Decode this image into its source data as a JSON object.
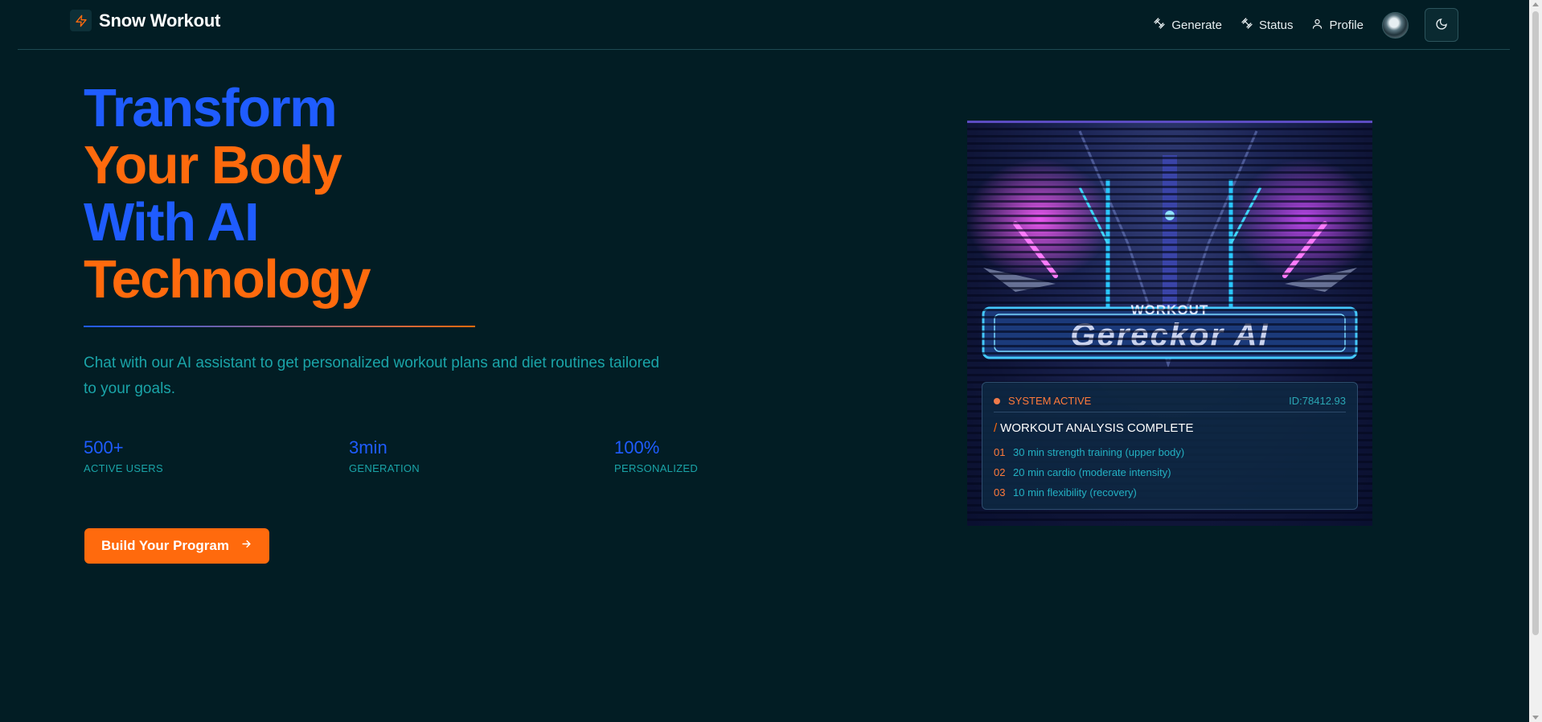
{
  "app": {
    "brand_name": "Snow Workout",
    "brand_icon": "zap-icon"
  },
  "nav": {
    "items": [
      {
        "label": "Generate",
        "icon": "dumbbell-icon"
      },
      {
        "label": "Status",
        "icon": "dumbbell-icon"
      },
      {
        "label": "Profile",
        "icon": "user-icon"
      }
    ],
    "theme_toggle_icon": "moon-icon"
  },
  "hero": {
    "title_lines": [
      "Transform",
      "Your Body",
      "With AI",
      "Technology"
    ],
    "subtitle": "Chat with our AI assistant to get personalized workout plans and diet routines tailored to your goals.",
    "stats": [
      {
        "value": "500+",
        "label": "ACTIVE USERS"
      },
      {
        "value": "3min",
        "label": "GENERATION"
      },
      {
        "value": "100%",
        "label": "PERSONALIZED"
      }
    ],
    "cta_label": "Build Your Program",
    "cta_icon": "arrow-right-icon"
  },
  "showcase": {
    "banner_small": "WORKOUT",
    "banner_large": "Gereckor AI",
    "status": {
      "state": "SYSTEM ACTIVE",
      "id": "ID:78412.93",
      "title": "WORKOUT ANALYSIS COMPLETE",
      "items": [
        {
          "num": "01",
          "text": "30 min strength training (upper body)"
        },
        {
          "num": "02",
          "text": "20 min cardio (moderate intensity)"
        },
        {
          "num": "03",
          "text": "10 min flexibility (recovery)"
        }
      ]
    }
  },
  "colors": {
    "background": "#021d24",
    "accent_blue": "#1f5cff",
    "accent_orange": "#ff6a0d",
    "teal_text": "#1aa4a8"
  }
}
